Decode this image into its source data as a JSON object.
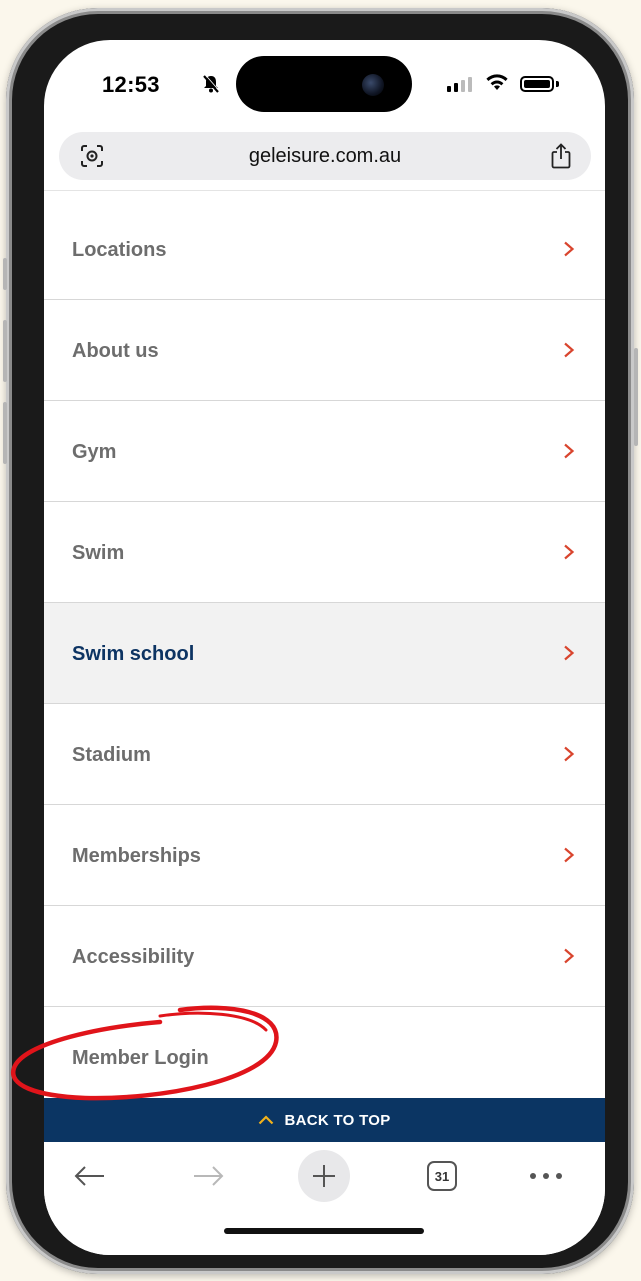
{
  "status_bar": {
    "time": "12:53",
    "silent_icon": "bell-slash-icon",
    "signal_bars_active": 2,
    "signal_bars_total": 4,
    "wifi_icon": "wifi-icon",
    "battery_level": 1.0
  },
  "browser": {
    "url": "geleisure.com.au",
    "left_icon": "visual-lookup-icon",
    "right_icon": "share-icon"
  },
  "menu": {
    "items": [
      {
        "label": "Locations",
        "has_chevron": true,
        "active": false
      },
      {
        "label": "About us",
        "has_chevron": true,
        "active": false
      },
      {
        "label": "Gym",
        "has_chevron": true,
        "active": false
      },
      {
        "label": "Swim",
        "has_chevron": true,
        "active": false
      },
      {
        "label": "Swim school",
        "has_chevron": true,
        "active": true
      },
      {
        "label": "Stadium",
        "has_chevron": true,
        "active": false
      },
      {
        "label": "Memberships",
        "has_chevron": true,
        "active": false
      },
      {
        "label": "Accessibility",
        "has_chevron": true,
        "active": false
      },
      {
        "label": "Member Login",
        "has_chevron": false,
        "active": false
      }
    ]
  },
  "back_to_top": {
    "label": "BACK TO TOP"
  },
  "toolbar": {
    "back_icon": "arrow-left-icon",
    "forward_icon": "arrow-right-icon",
    "new_tab_icon": "plus-icon",
    "tab_count": "31",
    "more_icon": "ellipsis-icon"
  },
  "colors": {
    "nav_blue": "#0b3563",
    "active_text": "#0d3463",
    "chevron_red": "#d9452e",
    "annotation_red": "#e0141a",
    "back_to_top_chevron": "#f2b21b"
  }
}
